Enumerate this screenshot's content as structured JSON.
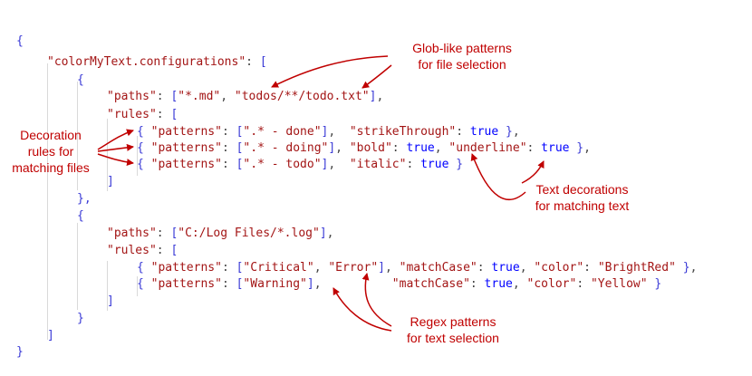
{
  "code": {
    "open_brace": "{",
    "config_key": "\"colorMyText.configurations\"",
    "colon": ": ",
    "open_bracket": "[",
    "block1": {
      "open": "{",
      "paths_key": "\"paths\"",
      "paths_values": [
        "\"*.md\"",
        "\"todos/**/todo.txt\""
      ],
      "rules_key": "\"rules\"",
      "rules": [
        {
          "pattern": "\".* - done\"",
          "decoration_key": "\"strikeThrough\"",
          "decoration_value": "true"
        },
        {
          "pattern": "\".* - doing\"",
          "decoration_key": "\"bold\"",
          "decoration_value": "true",
          "extra_key": "\"underline\"",
          "extra_value": "true"
        },
        {
          "pattern": "\".* - todo\"",
          "decoration_key": "\"italic\"",
          "decoration_value": "true"
        }
      ],
      "close_rules": "]",
      "close": "},"
    },
    "block2": {
      "open": "{",
      "paths_key": "\"paths\"",
      "paths_value": "\"C:/Log Files/*.log\"",
      "rules_key": "\"rules\"",
      "rules": [
        {
          "patterns": [
            "\"Critical\"",
            "\"Error\""
          ],
          "match_key": "\"matchCase\"",
          "match_value": "true",
          "color_key": "\"color\"",
          "color_value": "\"BrightRed\""
        },
        {
          "patterns": [
            "\"Warning\""
          ],
          "match_key": "\"matchCase\"",
          "match_value": "true",
          "color_key": "\"color\"",
          "color_value": "\"Yellow\""
        }
      ],
      "close_rules": "]",
      "close": "}"
    },
    "close_bracket": "]",
    "close_brace": "}",
    "patterns_key": "\"patterns\""
  },
  "annotations": {
    "glob": [
      "Glob-like patterns",
      "for file selection"
    ],
    "decoration_rules": [
      "Decoration",
      "rules for",
      "matching files"
    ],
    "text_decorations": [
      "Text decorations",
      "for matching text"
    ],
    "regex": [
      "Regex patterns",
      "for text selection"
    ]
  },
  "colors": {
    "annotation": "#c00000",
    "bracket": "#3a3ad6",
    "string": "#a31515",
    "keyword": "#0000ff"
  }
}
